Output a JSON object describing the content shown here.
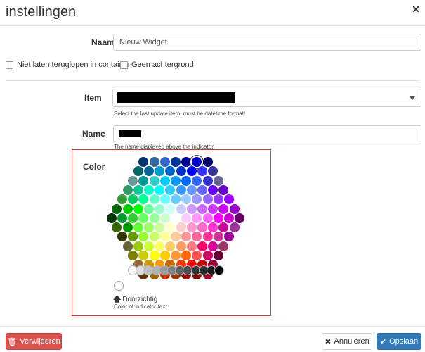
{
  "header": {
    "title": "instellingen",
    "close_glyph": "✕",
    "close_icon": "close-icon"
  },
  "form": {
    "naam_label": "Naam",
    "naam_value": "Nieuw Widget",
    "checkbox_wrap_label": "Niet laten teruglopen in container",
    "checkbox_bg_label": "Geen achtergrond",
    "item_label": "Item",
    "item_help": "Select the last update item, must be datetime format!",
    "name_label": "Name",
    "name_help": "The name displayed above the indicator.",
    "color_label": "Color",
    "transparent_label": "Doorzichtig",
    "color_help": "Color of indicator text.",
    "selected_color": "#0000cc"
  },
  "palette": {
    "hex_rows": [
      [
        "#003366",
        "#336699",
        "#3366cc",
        "#003399",
        "#000099",
        "#0000cc",
        "#000066"
      ],
      [
        "#006666",
        "#006699",
        "#0099cc",
        "#0066cc",
        "#0033cc",
        "#0000ff",
        "#3333ff",
        "#333399"
      ],
      [
        "#669999",
        "#009999",
        "#33cccc",
        "#00ccff",
        "#0099ff",
        "#0066ff",
        "#3366ff",
        "#3333cc",
        "#666699"
      ],
      [
        "#339966",
        "#00cc99",
        "#00ffcc",
        "#00ffff",
        "#33ccff",
        "#3399ff",
        "#6699ff",
        "#6666ff",
        "#6600ff",
        "#6600cc"
      ],
      [
        "#339933",
        "#00cc66",
        "#00ff99",
        "#66ffcc",
        "#66ffff",
        "#66ccff",
        "#99ccff",
        "#9999ff",
        "#9966ff",
        "#9933ff",
        "#9900ff"
      ],
      [
        "#006600",
        "#00cc00",
        "#00ff00",
        "#66ff99",
        "#99ffcc",
        "#ccffff",
        "#ccccff",
        "#cc99ff",
        "#cc66ff",
        "#cc33ff",
        "#cc00ff",
        "#9900cc"
      ],
      [
        "#003300",
        "#009933",
        "#33cc33",
        "#66ff66",
        "#99ff99",
        "#ccffcc",
        "#ffffff",
        "#ffccff",
        "#ff99ff",
        "#ff66ff",
        "#ff00ff",
        "#cc00cc",
        "#660066"
      ],
      [
        "#336600",
        "#009900",
        "#66ff33",
        "#99ff66",
        "#ccff99",
        "#ffffcc",
        "#ffcccc",
        "#ff99cc",
        "#ff66cc",
        "#ff33cc",
        "#cc0099",
        "#993399"
      ],
      [
        "#333300",
        "#669900",
        "#99ff33",
        "#ccff66",
        "#ffff99",
        "#ffcc99",
        "#ff9999",
        "#ff6699",
        "#ff3399",
        "#cc3399",
        "#990099"
      ],
      [
        "#666633",
        "#99cc00",
        "#ccff33",
        "#ffff66",
        "#ffcc66",
        "#ff9966",
        "#ff7c80",
        "#ff0066",
        "#d60093",
        "#993366"
      ],
      [
        "#808000",
        "#cccc00",
        "#ffff00",
        "#ffcc00",
        "#ff9933",
        "#ff6600",
        "#ff5050",
        "#cc0066",
        "#660033"
      ],
      [
        "#996633",
        "#cc9900",
        "#ff9900",
        "#cc6600",
        "#ff3300",
        "#ff0000",
        "#cc0000",
        "#990033"
      ],
      [
        "#663300",
        "#996600",
        "#cc3300",
        "#993300",
        "#990000",
        "#800000",
        "#a50021"
      ]
    ],
    "grays": [
      "#f8f8f8",
      "#dddddd",
      "#c0c0c0",
      "#b2b2b2",
      "#969696",
      "#808080",
      "#5f5f5f",
      "#4d4d4d",
      "#333333",
      "#292929",
      "#1c1c1c",
      "#000000"
    ]
  },
  "footer": {
    "delete_label": "Verwijderen",
    "cancel_label": "Annuleren",
    "save_label": "Opslaan",
    "delete_icon": "trash-icon",
    "cancel_icon": "close-icon",
    "save_icon": "check-icon"
  }
}
